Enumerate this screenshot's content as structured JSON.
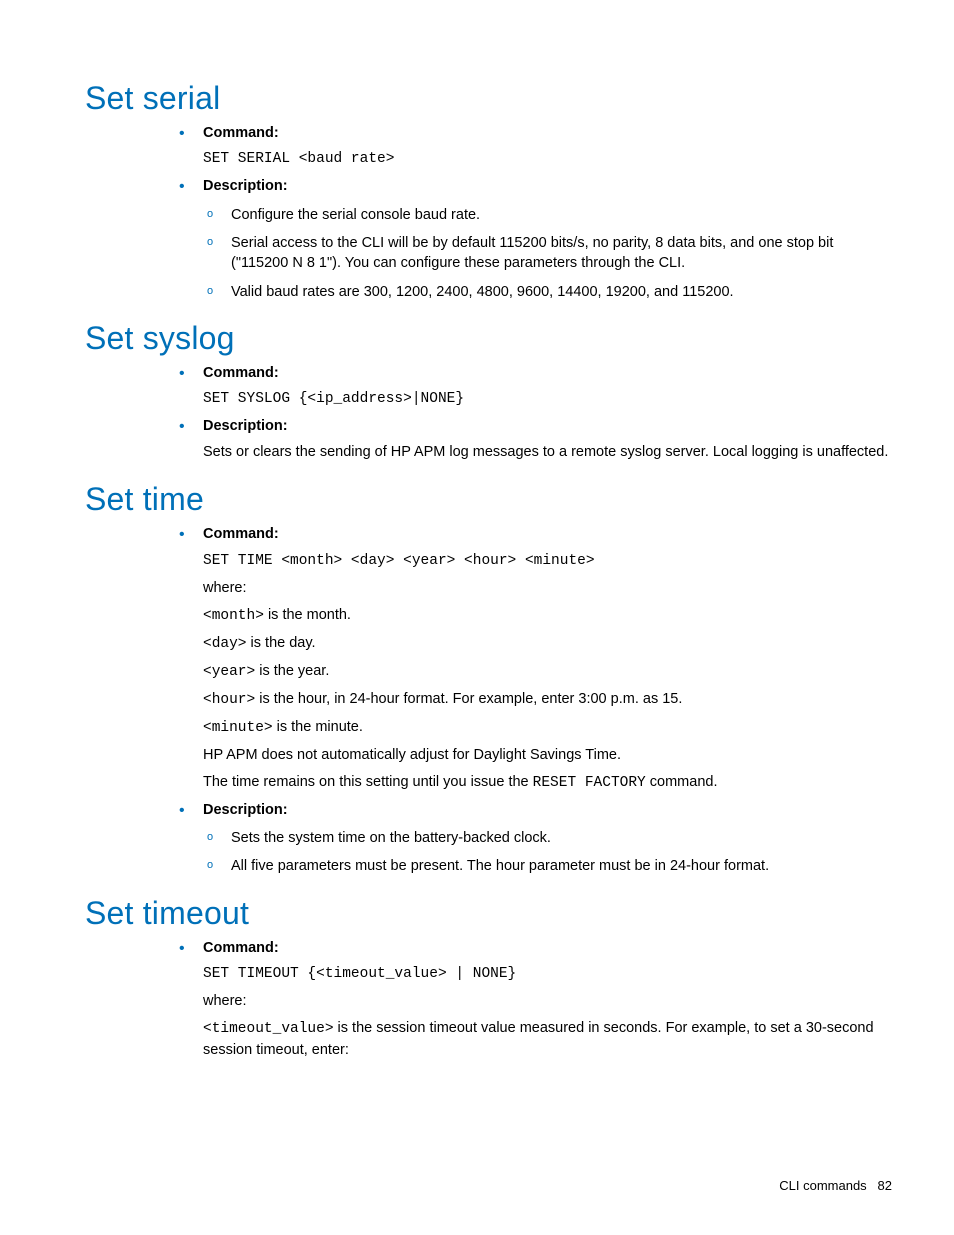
{
  "sections": {
    "serial": {
      "title": "Set serial",
      "command_label": "Command:",
      "command_code": "SET SERIAL <baud rate>",
      "description_label": "Description:",
      "desc1": "Configure the serial console baud rate.",
      "desc2": "Serial access to the CLI will be by default 115200 bits/s, no parity, 8 data bits, and one stop bit (\"115200 N 8 1\"). You can configure these parameters through the CLI.",
      "desc3": "Valid baud rates are 300, 1200, 2400, 4800, 9600, 14400, 19200, and 115200."
    },
    "syslog": {
      "title": "Set syslog",
      "command_label": "Command:",
      "command_code": "SET SYSLOG {<ip_address>|NONE}",
      "description_label": "Description:",
      "desc_text": "Sets or clears the sending of HP APM log messages to a remote syslog server. Local logging is unaffected."
    },
    "time": {
      "title": "Set time",
      "command_label": "Command:",
      "command_code": "SET TIME <month> <day> <year> <hour> <minute>",
      "where_label": "where:",
      "p_month_code": "<month>",
      "p_month_text": " is the month.",
      "p_day_code": "<day>",
      "p_day_text": " is the day.",
      "p_year_code": "<year>",
      "p_year_text": " is the year.",
      "p_hour_code": "<hour>",
      "p_hour_text": " is the hour, in 24-hour format. For example, enter 3:00 p.m. as 15.",
      "p_minute_code": "<minute>",
      "p_minute_text": " is the minute.",
      "p_dst": "HP APM does not automatically adjust for Daylight Savings Time.",
      "p_remain_pre": "The time remains on this setting until you issue the ",
      "p_remain_code": "RESET FACTORY",
      "p_remain_post": " command.",
      "description_label": "Description:",
      "desc1": "Sets the system time on the battery-backed clock.",
      "desc2": "All five parameters must be present. The hour parameter must be in 24-hour format."
    },
    "timeout": {
      "title": "Set timeout",
      "command_label": "Command:",
      "command_code": "SET TIMEOUT {<timeout_value> | NONE}",
      "where_label": "where:",
      "p_code": "<timeout_value>",
      "p_text": " is the session timeout value measured in seconds. For example, to set a 30-second session timeout, enter:"
    }
  },
  "footer": {
    "section_name": "CLI commands",
    "page_number": "82"
  }
}
